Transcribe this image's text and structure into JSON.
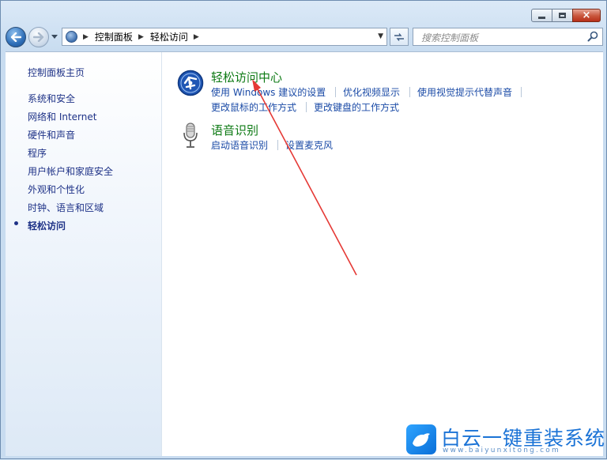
{
  "window": {
    "caption_minimize_glyph": "minimize-icon",
    "caption_maximize_glyph": "maximize-icon",
    "caption_close_glyph": "×"
  },
  "navbar": {
    "breadcrumb": [
      "控制面板",
      "轻松访问"
    ],
    "search_placeholder": "搜索控制面板"
  },
  "sidebar": {
    "items": [
      {
        "label": "控制面板主页",
        "active": false
      },
      {
        "label": "系统和安全",
        "active": false
      },
      {
        "label": "网络和 Internet",
        "active": false
      },
      {
        "label": "硬件和声音",
        "active": false
      },
      {
        "label": "程序",
        "active": false
      },
      {
        "label": "用户帐户和家庭安全",
        "active": false
      },
      {
        "label": "外观和个性化",
        "active": false
      },
      {
        "label": "时钟、语言和区域",
        "active": false
      },
      {
        "label": "轻松访问",
        "active": true
      }
    ]
  },
  "main": {
    "categories": [
      {
        "icon": "ease-of-access-icon",
        "title": "轻松访问中心",
        "tasks": [
          "使用 Windows 建议的设置",
          "优化视频显示",
          "使用视觉提示代替声音",
          "更改鼠标的工作方式",
          "更改键盘的工作方式"
        ]
      },
      {
        "icon": "microphone-icon",
        "title": "语音识别",
        "tasks": [
          "启动语音识别",
          "设置麦克风"
        ]
      }
    ]
  },
  "annotation": {
    "color": "#e53935"
  },
  "watermark": {
    "title": "白云一键重装系统",
    "url": "www.baiyunxitong.com",
    "brand_color": "#1b73d6"
  }
}
